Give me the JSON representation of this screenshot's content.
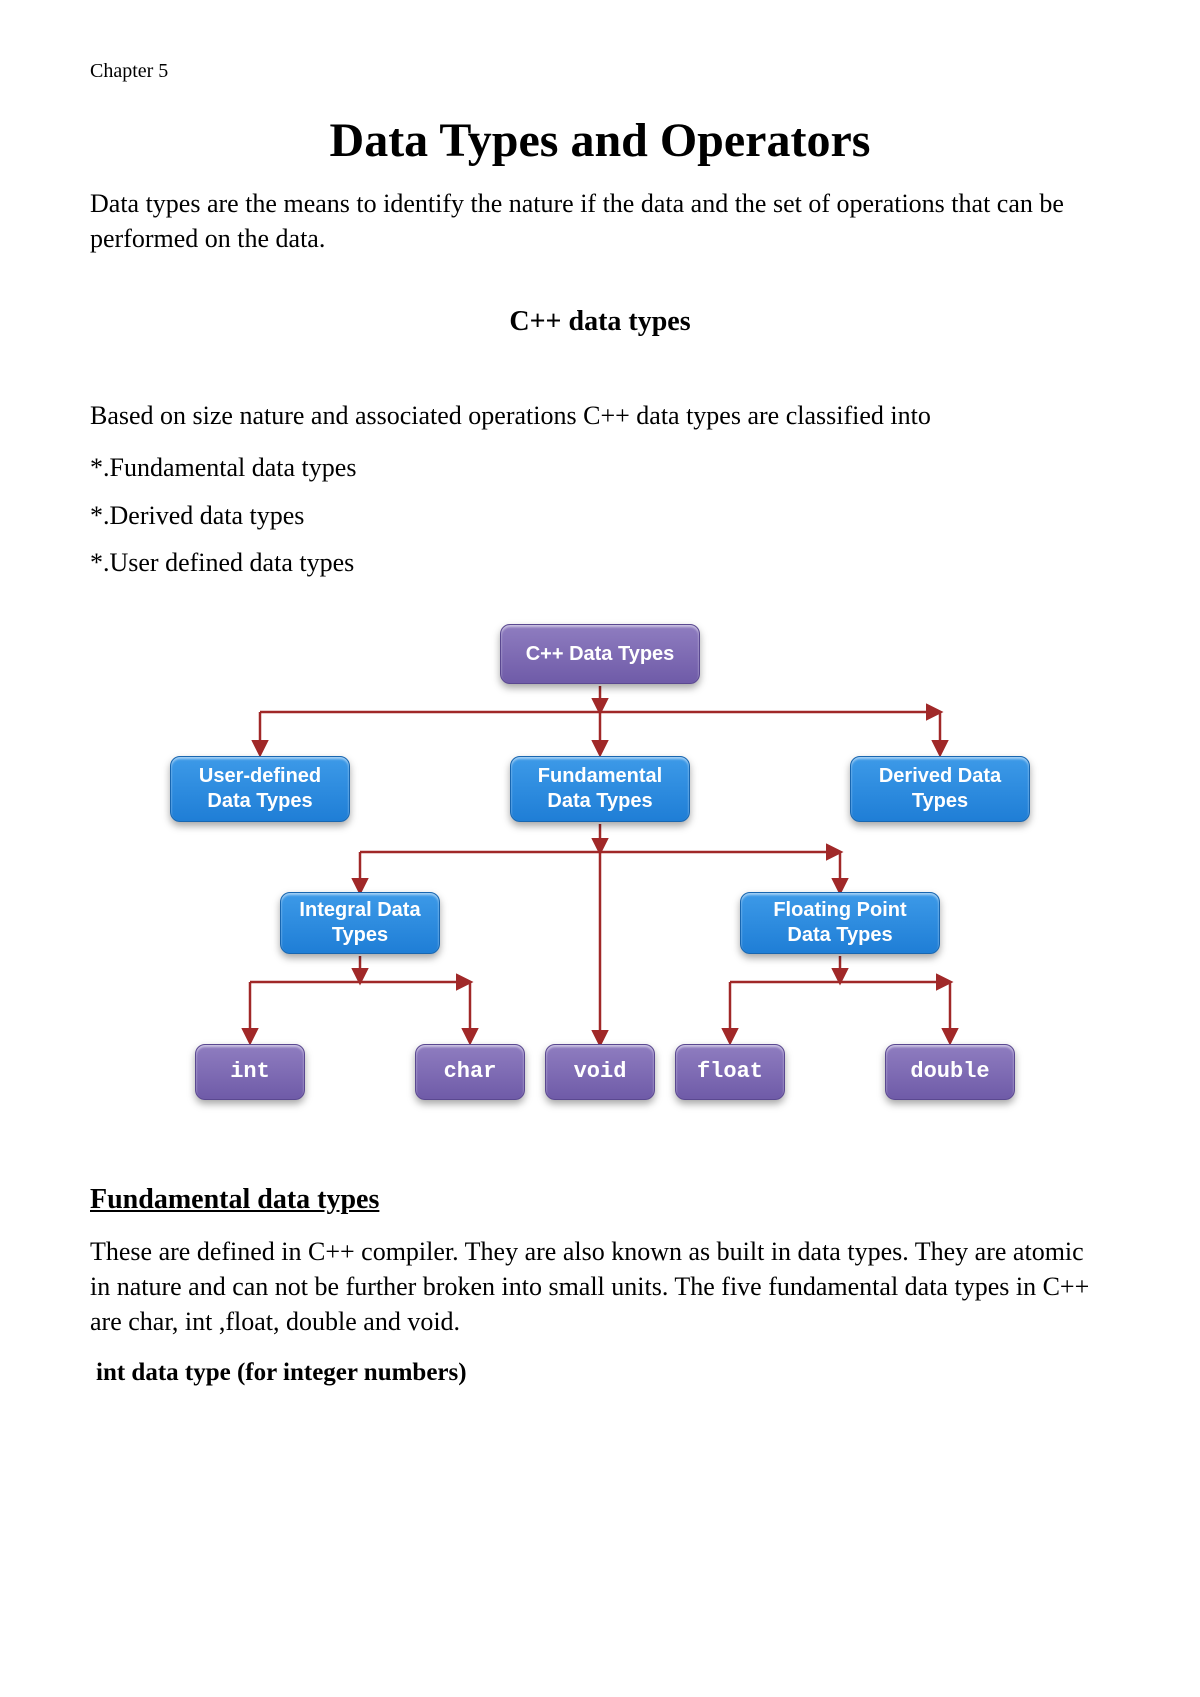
{
  "chapter_label": "Chapter 5",
  "title": "Data Types and Operators",
  "intro": "Data types are the means to identify the nature if the data and the set of operations that can be performed on the  data.",
  "section_heading": "C++ data types",
  "classification_intro": "Based on size nature and associated operations C++ data types are classified into",
  "bullets": {
    "b1": "*.Fundamental data types",
    "b2": "*.Derived data types",
    "b3": "*.User defined data types"
  },
  "diagram": {
    "root": "C++ Data Types",
    "mid_left": "User-defined Data Types",
    "mid_center": "Fundamental Data  Types",
    "mid_right": "Derived Data Types",
    "sub_left": "Integral Data Types",
    "sub_right": "Floating Point Data Types",
    "leaf1": "int",
    "leaf2": "char",
    "leaf3": "void",
    "leaf4": "float",
    "leaf5": "double"
  },
  "fund_heading": "Fundamental data types",
  "fund_para": "These are defined in C++ compiler. They are also known as built in data types. They are atomic in nature and can not be further broken into small units. The five fundamental data types in C++ are char, int ,float, double and void.",
  "int_heading": "int data type (for integer numbers)"
}
